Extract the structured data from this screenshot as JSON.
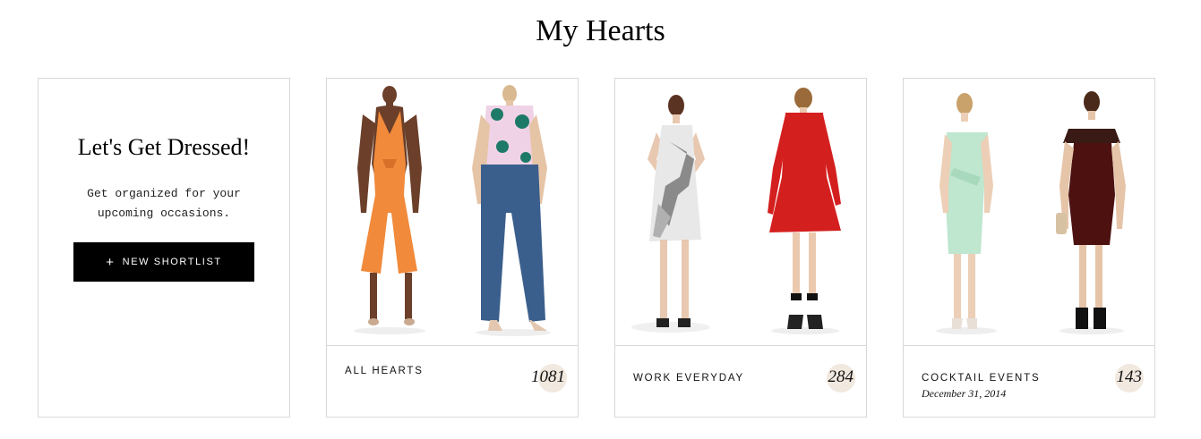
{
  "page": {
    "title": "My Hearts"
  },
  "intro": {
    "heading": "Let's Get Dressed!",
    "text": "Get organized for your upcoming occasions.",
    "button_label": "NEW SHORTLIST",
    "button_icon": "+"
  },
  "shortlists": [
    {
      "name": "ALL HEARTS",
      "count": "1081",
      "date": ""
    },
    {
      "name": "WORK EVERYDAY",
      "count": "284",
      "date": ""
    },
    {
      "name": "COCKTAIL EVENTS",
      "count": "143",
      "date": "December 31, 2014"
    }
  ],
  "colors": {
    "badge": "#f1e8df",
    "button": "#000000",
    "border": "#d8d8d8"
  }
}
